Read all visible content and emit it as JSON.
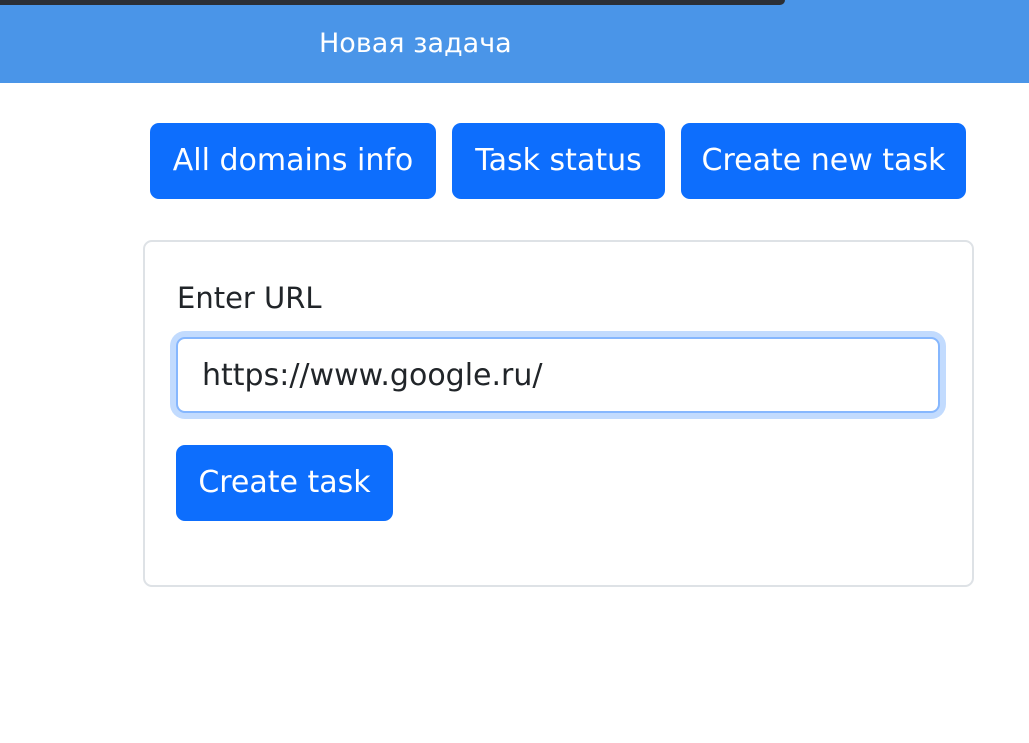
{
  "header": {
    "title": "Новая задача",
    "background_color": "#4a95e8"
  },
  "nav": {
    "all_domains_label": "All domains info",
    "task_status_label": "Task status",
    "create_new_task_label": "Create new task",
    "button_color": "#0d6efd"
  },
  "form": {
    "url_label": "Enter URL",
    "url_value": "https://www.google.ru/",
    "submit_label": "Create task"
  }
}
